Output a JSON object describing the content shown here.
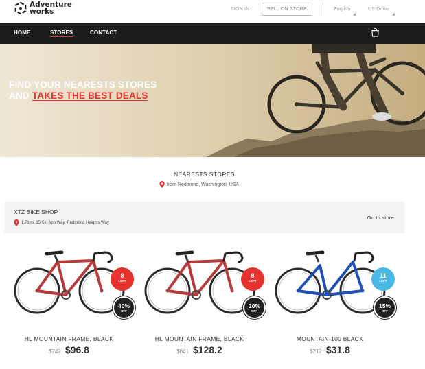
{
  "brand": {
    "line1": "Adventure",
    "line2": "works"
  },
  "topbar": {
    "sign_in": "SIGN IN",
    "sell_on_store": "SELL ON STORE",
    "language": "English",
    "currency": "US Dollar"
  },
  "nav": {
    "items": [
      {
        "label": "HOME"
      },
      {
        "label": "STORES"
      },
      {
        "label": "CONTACT"
      }
    ],
    "cart_icon": "shopping-bag-icon"
  },
  "hero": {
    "line1": "FIND YOUR NEARESTS STORES",
    "line2_prefix": "AND ",
    "line2_accent": "TAKES THE BEST DEALS"
  },
  "section": {
    "title": "NEARESTS STORES",
    "location": "from Redmond, Washington, USA"
  },
  "store": {
    "name": "XTZ BIKE SHOP",
    "address": "1.71mi, 15 Ski App Way, Redmond Heights Way",
    "go_label": "Go to store"
  },
  "products": [
    {
      "name": "HL MOUNTAIN FRAME, BLACK",
      "old_price": "$242",
      "price": "$96.8",
      "left_count": "8",
      "left_label": "LEFT",
      "discount": "40%",
      "off_label": "OFF",
      "badge_color": "#e6322e",
      "frame_color": "#b63a3a"
    },
    {
      "name": "HL MOUNTAIN FRAME, BLACK",
      "old_price": "$641",
      "price": "$128.2",
      "left_count": "8",
      "left_label": "LEFT",
      "discount": "20%",
      "off_label": "OFF",
      "badge_color": "#e6322e",
      "frame_color": "#b63a3a"
    },
    {
      "name": "MOUNTAIN-100 BLACK",
      "old_price": "$212",
      "price": "$31.8",
      "left_count": "11",
      "left_label": "LEFT",
      "discount": "15%",
      "off_label": "OFF",
      "badge_color": "#49b8e4",
      "frame_color": "#1f4fb5"
    }
  ],
  "colors": {
    "accent": "#e6322e",
    "nav_bg": "#1d1d1d",
    "store_bar_bg": "#f3f3f3"
  }
}
